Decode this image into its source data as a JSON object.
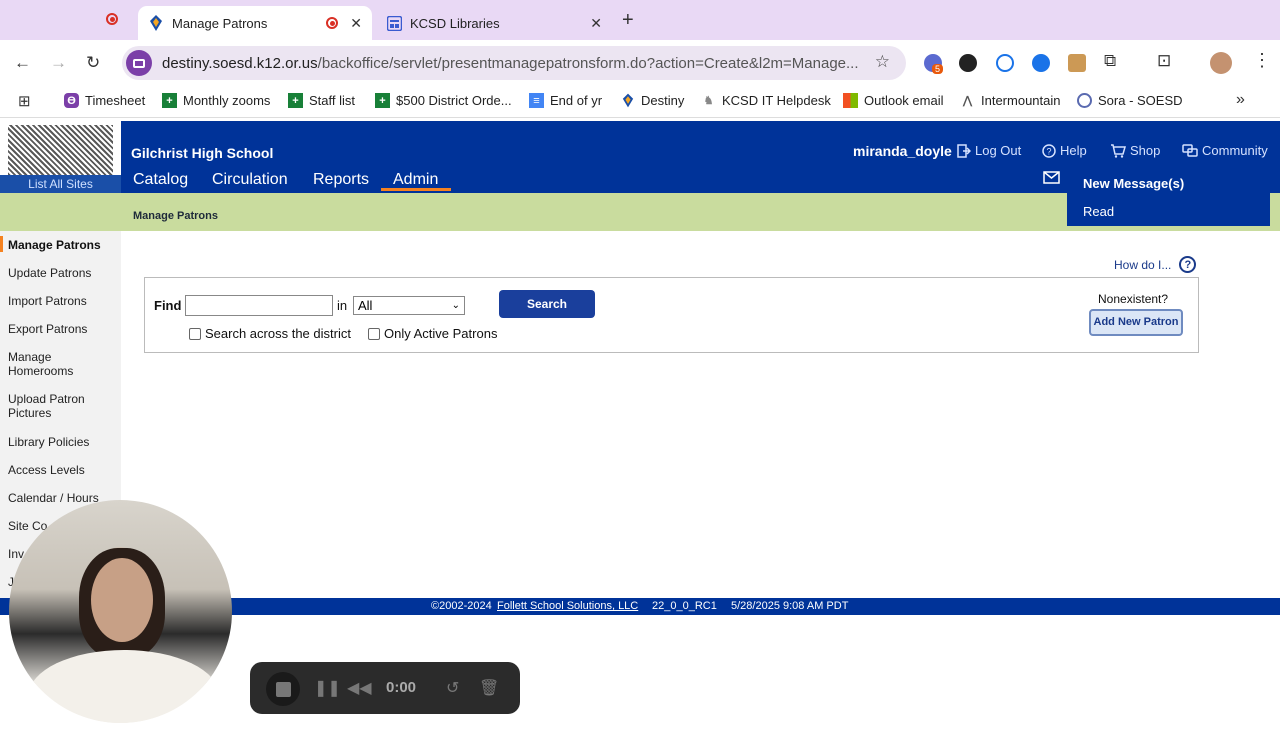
{
  "browser": {
    "tabs": [
      {
        "title": "Manage Patrons",
        "active": true
      },
      {
        "title": "KCSD Libraries",
        "active": false
      }
    ],
    "url_host": "destiny.soesd.k12.or.us",
    "url_path": "/backoffice/servlet/presentmanagepatronsform.do?action=Create&l2m=Manage...",
    "extension_badge": "5",
    "bookmarks": [
      "Timesheet",
      "Monthly zooms",
      "Staff list",
      "$500 District Orde...",
      "End of yr",
      "Destiny",
      "KCSD IT Helpdesk",
      "Outlook email",
      "Intermountain",
      "Sora - SOESD"
    ]
  },
  "header": {
    "list_all_sites": "List All Sites",
    "school": "Gilchrist High School",
    "nav": [
      "Catalog",
      "Circulation",
      "Reports",
      "Admin"
    ],
    "username": "miranda_doyle",
    "logout": "Log Out",
    "help": "Help",
    "shop": "Shop",
    "community": "Community"
  },
  "messages_menu": {
    "new": "New Message(s)",
    "read": "Read"
  },
  "subbar_title": "Manage Patrons",
  "sidebar": [
    "Manage Patrons",
    "Update Patrons",
    "Import Patrons",
    "Export Patrons",
    "Manage Homerooms",
    "Upload Patron Pictures",
    "Library Policies",
    "Access Levels",
    "Calendar / Hours",
    "Site Co",
    "Inv",
    "J"
  ],
  "help_link": "How do I...",
  "find": {
    "label": "Find",
    "in_label": "in",
    "scope_value": "All",
    "search_button": "Search",
    "across_district": "Search across the district",
    "only_active": "Only Active Patrons",
    "nonexistent": "Nonexistent?",
    "add_button": "Add New Patron"
  },
  "footer": {
    "copyright": "©2002-2024",
    "company": "Follett School Solutions, LLC",
    "version": "22_0_0_RC1",
    "timestamp": "5/28/2025 9:08 AM PDT"
  },
  "recorder": {
    "time": "0:00"
  },
  "colors": {
    "header_blue": "#003399",
    "subbar_green": "#c9dc9e",
    "accent_orange": "#f58220",
    "tabstrip": "#e9d9f5"
  }
}
